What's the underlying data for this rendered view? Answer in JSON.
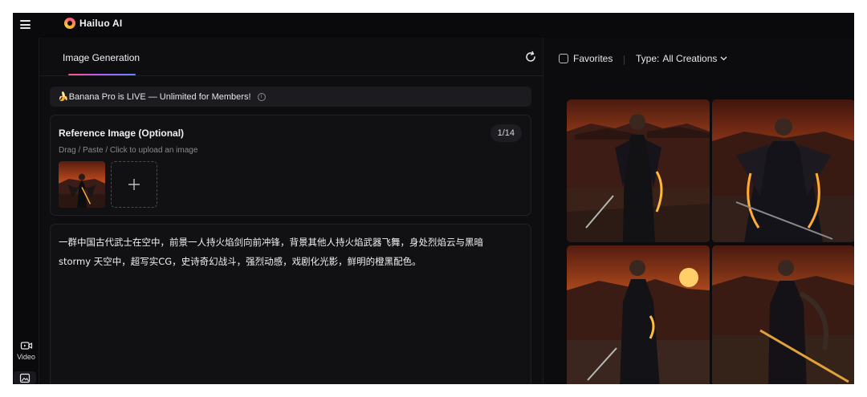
{
  "app": {
    "name": "Hailuo AI"
  },
  "rail": {
    "video_label": "Video"
  },
  "tabs": [
    {
      "label": "Image Generation",
      "active": true
    }
  ],
  "banner": {
    "text": "🍌Banana Pro is LIVE — Unlimited for Members!"
  },
  "reference": {
    "title": "Reference Image (Optional)",
    "count": "1/14",
    "hint": "Drag / Paste / Click to upload an image"
  },
  "prompt": {
    "line1": "一群中国古代武士在空中，前景一人持火焰剑向前冲锋，背景其他人持火焰武器飞舞，身处烈焰云与黑暗",
    "line2": "stormy 天空中，超写实CG，史诗奇幻战斗，强烈动感，戏剧化光影，鲜明的橙黑配色。"
  },
  "filters": {
    "favorites_label": "Favorites",
    "favorites_checked": false,
    "type_label": "Type:",
    "type_value": "All Creations"
  },
  "results": {
    "count": 4
  },
  "colors": {
    "accent_gradient": [
      "#ff5a7a",
      "#b15cff",
      "#5f8bff"
    ],
    "background": "#0c0c0e",
    "sky": "#c24a1c"
  }
}
